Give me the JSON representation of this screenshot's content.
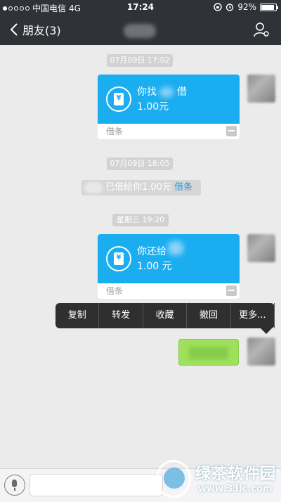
{
  "status_bar": {
    "carrier": "中国电信",
    "network": "4G",
    "time": "17:24",
    "battery": "92%",
    "battery_level": 0.92
  },
  "nav": {
    "back_label": "朋友(3)"
  },
  "chat": {
    "time1": "07月09日 17:02",
    "card1": {
      "title": "你找",
      "title_suffix": "借",
      "amount": "1.00元",
      "footer": "借条"
    },
    "time2": "07月09日 18:05",
    "system_msg": {
      "text": "已借给你1.00元",
      "link": "借条"
    },
    "time3": "星期三 19:20",
    "card2": {
      "title": "你还给",
      "amount": "1.00 元",
      "footer": "借条"
    }
  },
  "context_menu": {
    "items": [
      "复制",
      "转发",
      "收藏",
      "撤回",
      "更多..."
    ]
  },
  "watermark": {
    "title": "绿茶软件园",
    "url": "www.33lc.com"
  },
  "colors": {
    "nav_bg": "#2f3337",
    "card_blue": "#1aadf0",
    "bubble_green": "#9fe15a",
    "chat_bg": "#ebebeb"
  }
}
